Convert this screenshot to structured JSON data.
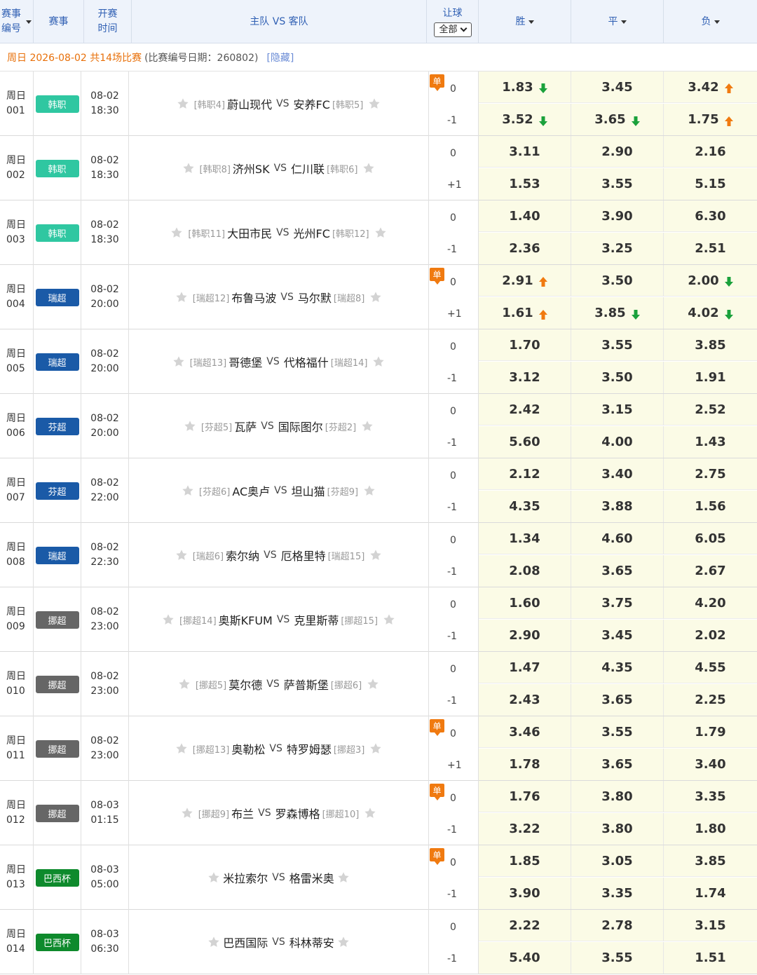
{
  "header": {
    "no": "赛事编号",
    "no_line1": "赛事",
    "no_line2": "编号",
    "league": "赛事",
    "time_line1": "开赛",
    "time_line2": "时间",
    "teams": "主队 VS 客队",
    "handicap": "让球",
    "handicap_select": "全部",
    "win": "胜",
    "draw": "平",
    "lose": "负"
  },
  "date_bar": {
    "day_text": "周日 2026-08-02 共14场比赛",
    "code_text": "(比赛编号日期：260802)",
    "hide_link": "[隐藏]"
  },
  "colors": {
    "kleague": "#2fc7a1",
    "allsvenskan": "#1a5aa7",
    "veikkausliiga": "#1a5aa7",
    "eliteserien": "#666666",
    "brazil_cup": "#0e8a2c",
    "up_arrow": "#f07a10",
    "down_arrow": "#1aa13b"
  },
  "matches": [
    {
      "day": "周日",
      "no": "001",
      "league": "韩职",
      "league_color": "#2fc7a1",
      "date": "08-02",
      "time": "18:30",
      "home_rank": "[韩职4]",
      "home": "蔚山现代",
      "vs": "VS",
      "away": "安养FC",
      "away_rank": "[韩职5]",
      "single": true,
      "hcp_top": "0",
      "hcp_bot": "-1",
      "odds_top": {
        "win": "1.83",
        "win_arrow": "down",
        "draw": "3.45",
        "draw_arrow": "",
        "lose": "3.42",
        "lose_arrow": "up"
      },
      "odds_bot": {
        "win": "3.52",
        "win_arrow": "down",
        "draw": "3.65",
        "draw_arrow": "down",
        "lose": "1.75",
        "lose_arrow": "up"
      }
    },
    {
      "day": "周日",
      "no": "002",
      "league": "韩职",
      "league_color": "#2fc7a1",
      "date": "08-02",
      "time": "18:30",
      "home_rank": "[韩职8]",
      "home": "济州SK",
      "vs": "VS",
      "away": "仁川联",
      "away_rank": "[韩职6]",
      "single": false,
      "hcp_top": "0",
      "hcp_bot": "+1",
      "odds_top": {
        "win": "3.11",
        "win_arrow": "",
        "draw": "2.90",
        "draw_arrow": "",
        "lose": "2.16",
        "lose_arrow": ""
      },
      "odds_bot": {
        "win": "1.53",
        "win_arrow": "",
        "draw": "3.55",
        "draw_arrow": "",
        "lose": "5.15",
        "lose_arrow": ""
      }
    },
    {
      "day": "周日",
      "no": "003",
      "league": "韩职",
      "league_color": "#2fc7a1",
      "date": "08-02",
      "time": "18:30",
      "home_rank": "[韩职11]",
      "home": "大田市民",
      "vs": "VS",
      "away": "光州FC",
      "away_rank": "[韩职12]",
      "single": false,
      "hcp_top": "0",
      "hcp_bot": "-1",
      "odds_top": {
        "win": "1.40",
        "win_arrow": "",
        "draw": "3.90",
        "draw_arrow": "",
        "lose": "6.30",
        "lose_arrow": ""
      },
      "odds_bot": {
        "win": "2.36",
        "win_arrow": "",
        "draw": "3.25",
        "draw_arrow": "",
        "lose": "2.51",
        "lose_arrow": ""
      }
    },
    {
      "day": "周日",
      "no": "004",
      "league": "瑞超",
      "league_color": "#1a5aa7",
      "date": "08-02",
      "time": "20:00",
      "home_rank": "[瑞超12]",
      "home": "布鲁马波",
      "vs": "VS",
      "away": "马尔默",
      "away_rank": "[瑞超8]",
      "single": true,
      "hcp_top": "0",
      "hcp_bot": "+1",
      "odds_top": {
        "win": "2.91",
        "win_arrow": "up",
        "draw": "3.50",
        "draw_arrow": "",
        "lose": "2.00",
        "lose_arrow": "down"
      },
      "odds_bot": {
        "win": "1.61",
        "win_arrow": "up",
        "draw": "3.85",
        "draw_arrow": "down",
        "lose": "4.02",
        "lose_arrow": "down"
      }
    },
    {
      "day": "周日",
      "no": "005",
      "league": "瑞超",
      "league_color": "#1a5aa7",
      "date": "08-02",
      "time": "20:00",
      "home_rank": "[瑞超13]",
      "home": "哥德堡",
      "vs": "VS",
      "away": "代格福什",
      "away_rank": "[瑞超14]",
      "single": false,
      "hcp_top": "0",
      "hcp_bot": "-1",
      "odds_top": {
        "win": "1.70",
        "win_arrow": "",
        "draw": "3.55",
        "draw_arrow": "",
        "lose": "3.85",
        "lose_arrow": ""
      },
      "odds_bot": {
        "win": "3.12",
        "win_arrow": "",
        "draw": "3.50",
        "draw_arrow": "",
        "lose": "1.91",
        "lose_arrow": ""
      }
    },
    {
      "day": "周日",
      "no": "006",
      "league": "芬超",
      "league_color": "#1a5aa7",
      "date": "08-02",
      "time": "20:00",
      "home_rank": "[芬超5]",
      "home": "瓦萨",
      "vs": "VS",
      "away": "国际图尔",
      "away_rank": "[芬超2]",
      "single": false,
      "hcp_top": "0",
      "hcp_bot": "-1",
      "odds_top": {
        "win": "2.42",
        "win_arrow": "",
        "draw": "3.15",
        "draw_arrow": "",
        "lose": "2.52",
        "lose_arrow": ""
      },
      "odds_bot": {
        "win": "5.60",
        "win_arrow": "",
        "draw": "4.00",
        "draw_arrow": "",
        "lose": "1.43",
        "lose_arrow": ""
      }
    },
    {
      "day": "周日",
      "no": "007",
      "league": "芬超",
      "league_color": "#1a5aa7",
      "date": "08-02",
      "time": "22:00",
      "home_rank": "[芬超6]",
      "home": "AC奥卢",
      "vs": "VS",
      "away": "坦山猫",
      "away_rank": "[芬超9]",
      "single": false,
      "hcp_top": "0",
      "hcp_bot": "-1",
      "odds_top": {
        "win": "2.12",
        "win_arrow": "",
        "draw": "3.40",
        "draw_arrow": "",
        "lose": "2.75",
        "lose_arrow": ""
      },
      "odds_bot": {
        "win": "4.35",
        "win_arrow": "",
        "draw": "3.88",
        "draw_arrow": "",
        "lose": "1.56",
        "lose_arrow": ""
      }
    },
    {
      "day": "周日",
      "no": "008",
      "league": "瑞超",
      "league_color": "#1a5aa7",
      "date": "08-02",
      "time": "22:30",
      "home_rank": "[瑞超6]",
      "home": "索尔纳",
      "vs": "VS",
      "away": "厄格里特",
      "away_rank": "[瑞超15]",
      "single": false,
      "hcp_top": "0",
      "hcp_bot": "-1",
      "odds_top": {
        "win": "1.34",
        "win_arrow": "",
        "draw": "4.60",
        "draw_arrow": "",
        "lose": "6.05",
        "lose_arrow": ""
      },
      "odds_bot": {
        "win": "2.08",
        "win_arrow": "",
        "draw": "3.65",
        "draw_arrow": "",
        "lose": "2.67",
        "lose_arrow": ""
      }
    },
    {
      "day": "周日",
      "no": "009",
      "league": "挪超",
      "league_color": "#666666",
      "date": "08-02",
      "time": "23:00",
      "home_rank": "[挪超14]",
      "home": "奥斯KFUM",
      "vs": "VS",
      "away": "克里斯蒂",
      "away_rank": "[挪超15]",
      "single": false,
      "hcp_top": "0",
      "hcp_bot": "-1",
      "odds_top": {
        "win": "1.60",
        "win_arrow": "",
        "draw": "3.75",
        "draw_arrow": "",
        "lose": "4.20",
        "lose_arrow": ""
      },
      "odds_bot": {
        "win": "2.90",
        "win_arrow": "",
        "draw": "3.45",
        "draw_arrow": "",
        "lose": "2.02",
        "lose_arrow": ""
      }
    },
    {
      "day": "周日",
      "no": "010",
      "league": "挪超",
      "league_color": "#666666",
      "date": "08-02",
      "time": "23:00",
      "home_rank": "[挪超5]",
      "home": "莫尔德",
      "vs": "VS",
      "away": "萨普斯堡",
      "away_rank": "[挪超6]",
      "single": false,
      "hcp_top": "0",
      "hcp_bot": "-1",
      "odds_top": {
        "win": "1.47",
        "win_arrow": "",
        "draw": "4.35",
        "draw_arrow": "",
        "lose": "4.55",
        "lose_arrow": ""
      },
      "odds_bot": {
        "win": "2.43",
        "win_arrow": "",
        "draw": "3.65",
        "draw_arrow": "",
        "lose": "2.25",
        "lose_arrow": ""
      }
    },
    {
      "day": "周日",
      "no": "011",
      "league": "挪超",
      "league_color": "#666666",
      "date": "08-02",
      "time": "23:00",
      "home_rank": "[挪超13]",
      "home": "奥勒松",
      "vs": "VS",
      "away": "特罗姆瑟",
      "away_rank": "[挪超3]",
      "single": true,
      "hcp_top": "0",
      "hcp_bot": "+1",
      "odds_top": {
        "win": "3.46",
        "win_arrow": "",
        "draw": "3.55",
        "draw_arrow": "",
        "lose": "1.79",
        "lose_arrow": ""
      },
      "odds_bot": {
        "win": "1.78",
        "win_arrow": "",
        "draw": "3.65",
        "draw_arrow": "",
        "lose": "3.40",
        "lose_arrow": ""
      }
    },
    {
      "day": "周日",
      "no": "012",
      "league": "挪超",
      "league_color": "#666666",
      "date": "08-03",
      "time": "01:15",
      "home_rank": "[挪超9]",
      "home": "布兰",
      "vs": "VS",
      "away": "罗森博格",
      "away_rank": "[挪超10]",
      "single": true,
      "hcp_top": "0",
      "hcp_bot": "-1",
      "odds_top": {
        "win": "1.76",
        "win_arrow": "",
        "draw": "3.80",
        "draw_arrow": "",
        "lose": "3.35",
        "lose_arrow": ""
      },
      "odds_bot": {
        "win": "3.22",
        "win_arrow": "",
        "draw": "3.80",
        "draw_arrow": "",
        "lose": "1.80",
        "lose_arrow": ""
      }
    },
    {
      "day": "周日",
      "no": "013",
      "league": "巴西杯",
      "league_color": "#0e8a2c",
      "date": "08-03",
      "time": "05:00",
      "home_rank": "",
      "home": "米拉索尔",
      "vs": "VS",
      "away": "格雷米奥",
      "away_rank": "",
      "single": true,
      "hcp_top": "0",
      "hcp_bot": "-1",
      "odds_top": {
        "win": "1.85",
        "win_arrow": "",
        "draw": "3.05",
        "draw_arrow": "",
        "lose": "3.85",
        "lose_arrow": ""
      },
      "odds_bot": {
        "win": "3.90",
        "win_arrow": "",
        "draw": "3.35",
        "draw_arrow": "",
        "lose": "1.74",
        "lose_arrow": ""
      }
    },
    {
      "day": "周日",
      "no": "014",
      "league": "巴西杯",
      "league_color": "#0e8a2c",
      "date": "08-03",
      "time": "06:30",
      "home_rank": "",
      "home": "巴西国际",
      "vs": "VS",
      "away": "科林蒂安",
      "away_rank": "",
      "single": false,
      "hcp_top": "0",
      "hcp_bot": "-1",
      "odds_top": {
        "win": "2.22",
        "win_arrow": "",
        "draw": "2.78",
        "draw_arrow": "",
        "lose": "3.15",
        "lose_arrow": ""
      },
      "odds_bot": {
        "win": "5.40",
        "win_arrow": "",
        "draw": "3.55",
        "draw_arrow": "",
        "lose": "1.51",
        "lose_arrow": ""
      }
    }
  ]
}
